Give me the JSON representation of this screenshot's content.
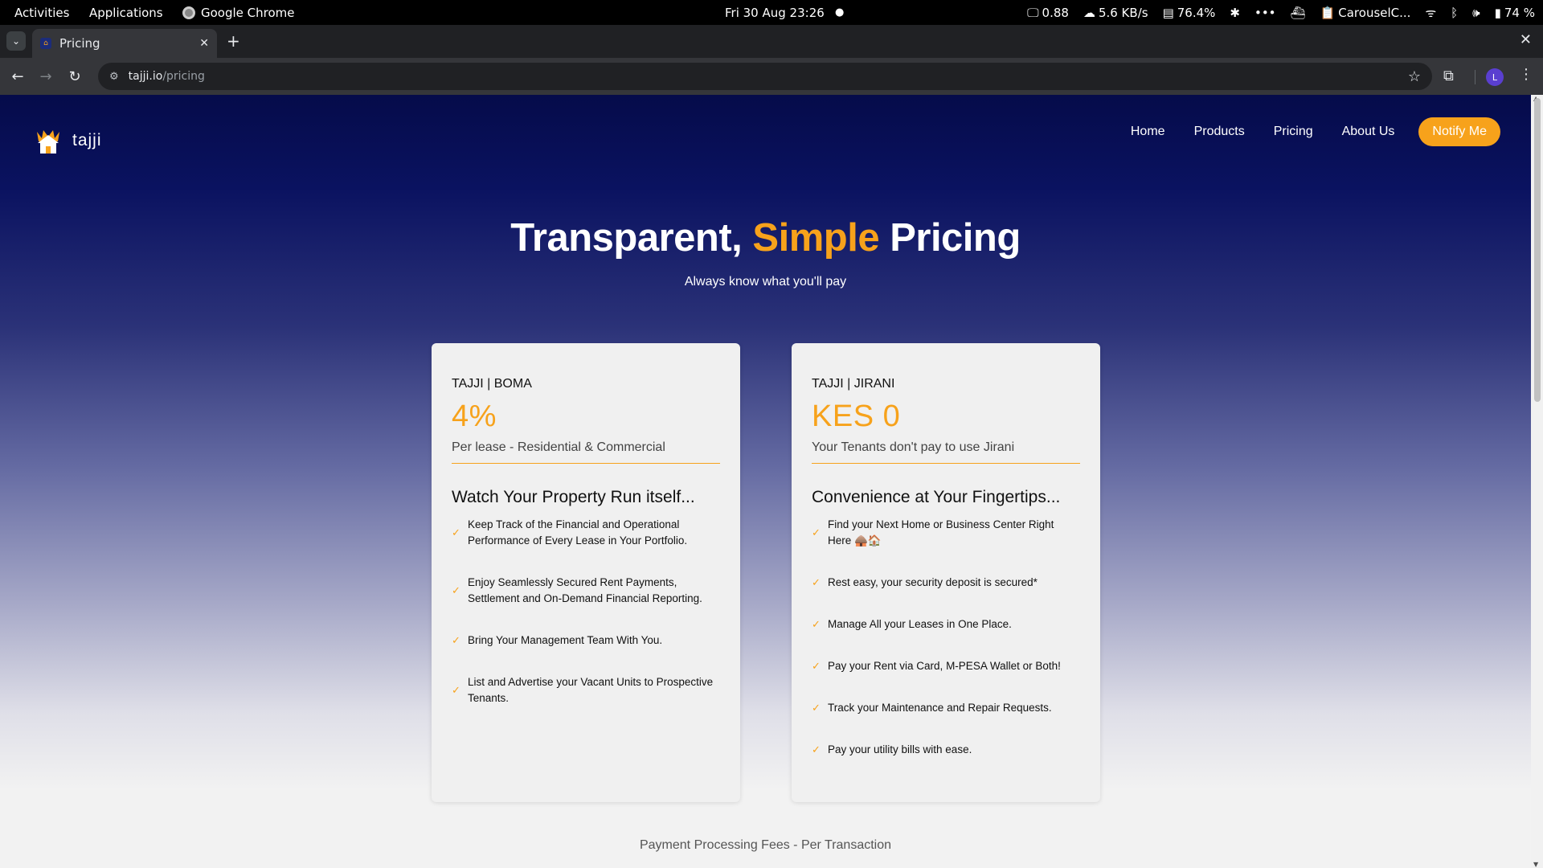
{
  "system_bar": {
    "activities": "Activities",
    "applications": "Applications",
    "active_app": "Google Chrome",
    "clock": "Fri 30 Aug  23:26",
    "load": "0.88",
    "network": "5.6 KB/s",
    "memory": "76.4%",
    "clipboard": "CarouselC...",
    "battery": "74 %"
  },
  "browser": {
    "tab_title": "Pricing",
    "url_host": "tajji.io",
    "url_path": "/pricing",
    "profile_initial": "L"
  },
  "site": {
    "logo_text": "tajji",
    "nav": [
      "Home",
      "Products",
      "Pricing",
      "About Us"
    ],
    "notify_label": "Notify Me",
    "accent_color": "#f7a21b"
  },
  "hero": {
    "title_part1": "Transparent, ",
    "title_accent": "Simple",
    "title_part2": " Pricing",
    "subtitle": "Always know what you'll pay"
  },
  "plans": [
    {
      "name": "TAJJI | BOMA",
      "price": "4%",
      "price_note": "Per lease - Residential & Commercial",
      "features_heading": "Watch Your Property Run itself...",
      "features": [
        "Keep Track of the Financial and Operational Performance of Every Lease in Your Portfolio.",
        "Enjoy Seamlessly Secured Rent Payments, Settlement and On-Demand Financial Reporting.",
        "Bring Your Management Team With You.",
        "List and Advertise your Vacant Units to Prospective Tenants."
      ]
    },
    {
      "name": "TAJJI | JIRANI",
      "price": "KES 0",
      "price_note": "Your Tenants don't pay to use Jirani",
      "features_heading": "Convenience at Your Fingertips...",
      "features": [
        "Find your Next Home or Business Center Right Here 🛖🏠",
        "Rest easy, your security deposit is secured*",
        "Manage All your Leases in One Place.",
        "Pay your Rent via Card, M-PESA Wallet or Both!",
        "Track your Maintenance and Repair Requests.",
        "Pay your utility bills with ease."
      ]
    }
  ],
  "fees_caption": "Payment Processing Fees - Per Transaction"
}
